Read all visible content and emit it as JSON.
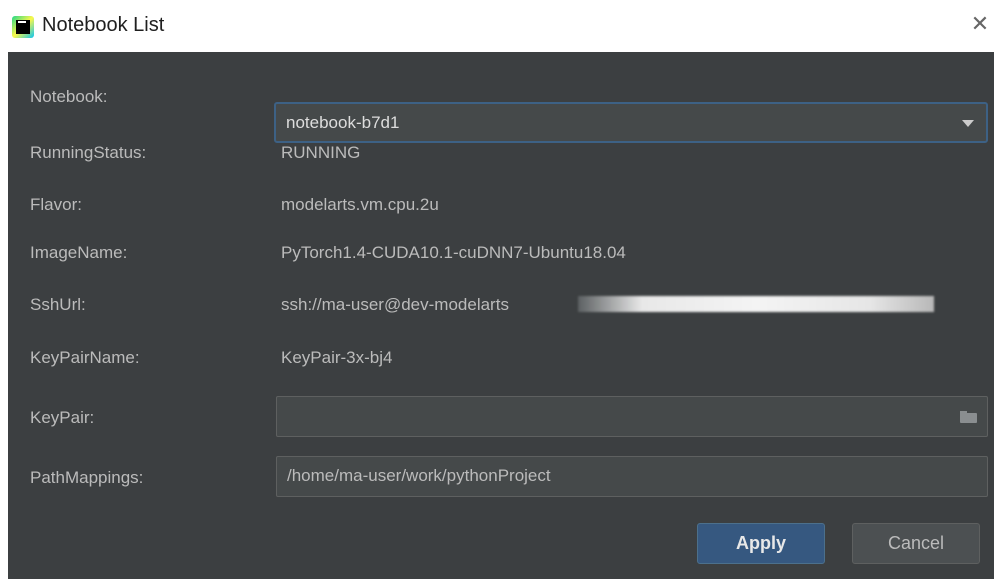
{
  "window": {
    "title": "Notebook List",
    "close_glyph": "✕",
    "app_icon": "pycharm-icon"
  },
  "form": {
    "notebook": {
      "label": "Notebook:",
      "value": "notebook-b7d1"
    },
    "running_status": {
      "label": "RunningStatus:",
      "value": "RUNNING"
    },
    "flavor": {
      "label": "Flavor:",
      "value": "modelarts.vm.cpu.2u"
    },
    "image_name": {
      "label": "ImageName:",
      "value": "PyTorch1.4-CUDA10.1-cuDNN7-Ubuntu18.04"
    },
    "ssh_url": {
      "label": "SshUrl:",
      "value": "ssh://ma-user@dev-modelarts"
    },
    "key_pair_name": {
      "label": "KeyPairName:",
      "value": "KeyPair-3x-bj4"
    },
    "key_pair": {
      "label": "KeyPair:",
      "value": ""
    },
    "path_mappings": {
      "label": "PathMappings:",
      "value": "/home/ma-user/work/pythonProject"
    }
  },
  "buttons": {
    "apply": "Apply",
    "cancel": "Cancel"
  },
  "colors": {
    "panel_bg": "#3c3f41",
    "accent": "#365880",
    "focus_border": "#3d6185"
  }
}
